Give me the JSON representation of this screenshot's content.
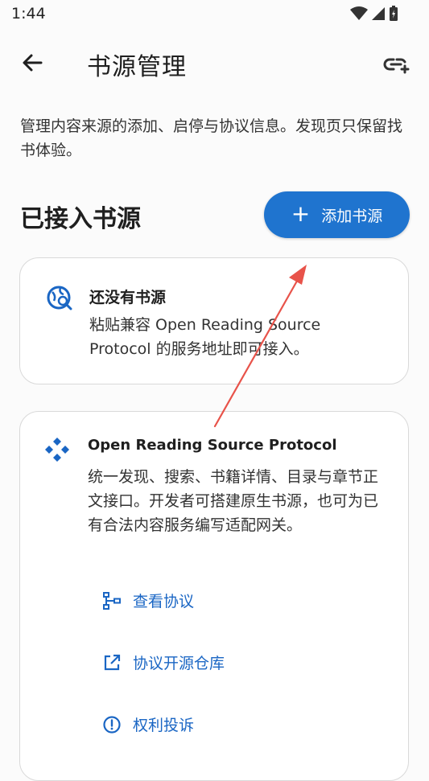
{
  "status_bar": {
    "time": "1:44"
  },
  "app_bar": {
    "title": "书源管理"
  },
  "description": "管理内容来源的添加、启停与协议信息。发现页只保留找书体验。",
  "section": {
    "title": "已接入书源",
    "add_button_label": "添加书源",
    "add_button_icon": "plus-icon"
  },
  "empty_card": {
    "title": "还没有书源",
    "body": "粘贴兼容 Open Reading Source Protocol 的服务地址即可接入。"
  },
  "protocol_card": {
    "title": "Open Reading Source Protocol",
    "body": "统一发现、搜索、书籍详情、目录与章节正文接口。开发者可搭建原生书源，也可为已有合法内容服务编写适配网关。",
    "actions": [
      {
        "label": "查看协议",
        "icon": "schema-icon"
      },
      {
        "label": "协议开源仓库",
        "icon": "open-external-icon"
      },
      {
        "label": "权利投诉",
        "icon": "report-icon"
      }
    ]
  },
  "colors": {
    "accent": "#1f74cf",
    "link": "#1a66c4",
    "annotation": "#e8534a"
  }
}
